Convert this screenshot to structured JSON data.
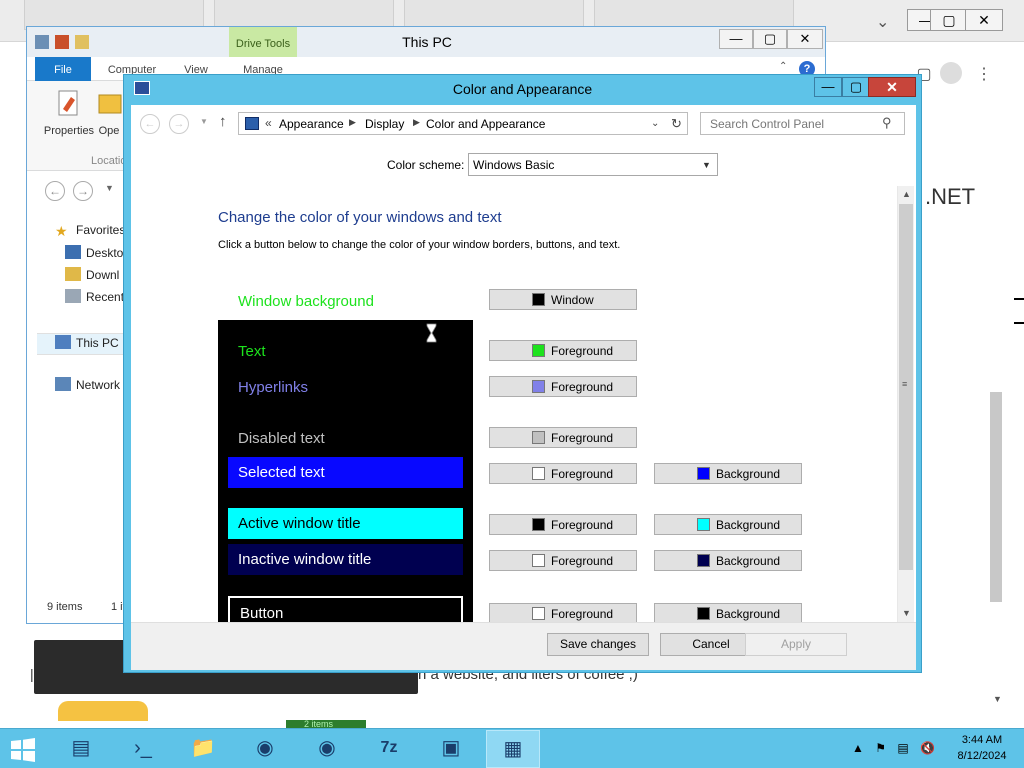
{
  "background_window": {
    "partial_heading": ".NET",
    "partial_text": "n a website, and liters of coffee ;)",
    "partial_pipe": "|",
    "items_tag": "2 items"
  },
  "explorer": {
    "title": "This PC",
    "drive_tools_tab": "Drive Tools",
    "ribbon_tabs": [
      "File",
      "Computer",
      "View",
      "Manage"
    ],
    "ribbon_buttons": [
      "Properties",
      "Ope"
    ],
    "ribbon_group": "Locatio",
    "tree": {
      "favorites": "Favorites",
      "desktop": "Deskto",
      "downloads": "Downl",
      "recent": "Recent",
      "this_pc": "This PC",
      "network": "Network"
    },
    "status_items": "9 items",
    "status_selected": "1 it"
  },
  "dialog": {
    "title": "Color and Appearance",
    "breadcrumbs": [
      "Appearance",
      "Display",
      "Color and Appearance"
    ],
    "address_prefix": "«",
    "search_placeholder": "Search Control Panel",
    "color_scheme_label": "Color scheme:",
    "color_scheme_value": "Windows Basic",
    "heading": "Change the color of your windows and text",
    "subtext": "Click a button below to change the color of your window borders, buttons, and text.",
    "preview": {
      "window_background": "Window background",
      "text": "Text",
      "hyperlinks": "Hyperlinks",
      "disabled_text": "Disabled text",
      "selected_text": "Selected text",
      "active_window_title": "Active window title",
      "inactive_window_title": "Inactive window title",
      "button": "Button"
    },
    "color_buttons": {
      "window": {
        "label": "Window",
        "color": "#000000"
      },
      "text_fg": {
        "label": "Foreground",
        "color": "#1de21d"
      },
      "hyperlinks_fg": {
        "label": "Foreground",
        "color": "#8080e8"
      },
      "disabled_fg": {
        "label": "Foreground",
        "color": "#c0c0c0"
      },
      "selected_fg": {
        "label": "Foreground",
        "color": "#ffffff"
      },
      "selected_bg": {
        "label": "Background",
        "color": "#0000ff"
      },
      "active_fg": {
        "label": "Foreground",
        "color": "#000000"
      },
      "active_bg": {
        "label": "Background",
        "color": "#00ffff"
      },
      "inactive_fg": {
        "label": "Foreground",
        "color": "#ffffff"
      },
      "inactive_bg": {
        "label": "Background",
        "color": "#000050"
      },
      "button_fg": {
        "label": "Foreground",
        "color": "#ffffff"
      },
      "button_bg": {
        "label": "Background",
        "color": "#000000"
      }
    },
    "footer": {
      "save": "Save changes",
      "cancel": "Cancel",
      "apply": "Apply"
    }
  },
  "taskbar": {
    "apps": [
      "server-manager-icon",
      "powershell-icon",
      "file-explorer-icon",
      "browser-icon",
      "pdf-icon",
      "7zip-icon",
      "network-tool-icon",
      "control-panel-icon"
    ],
    "seven_zip_label": "7z",
    "clock_time": "3:44 AM",
    "clock_date": "8/12/2024"
  }
}
